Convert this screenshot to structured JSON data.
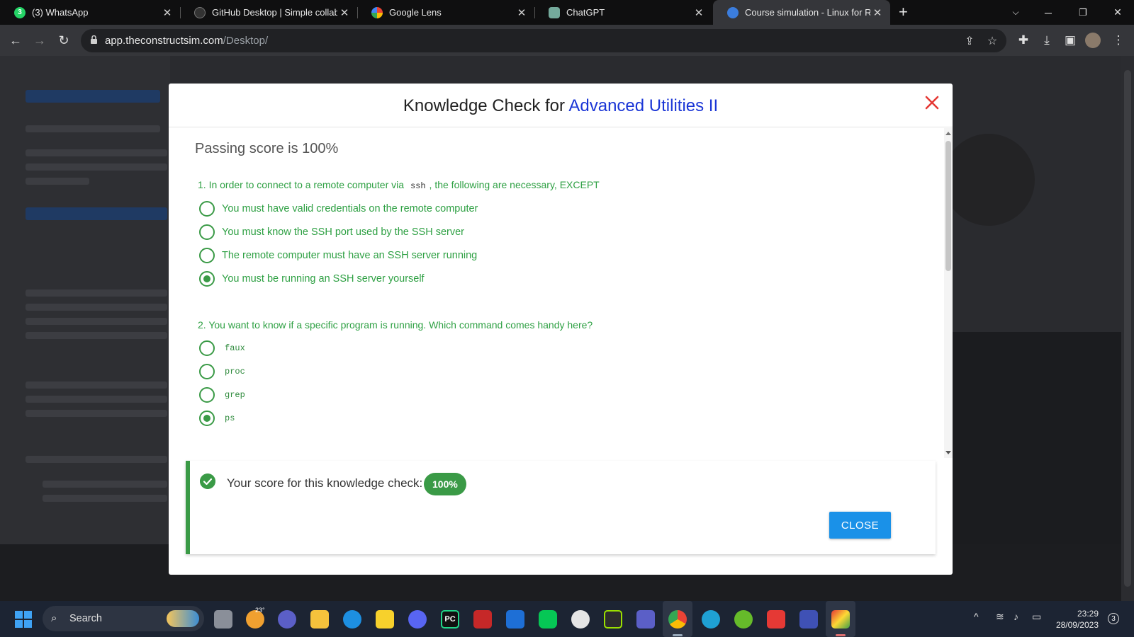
{
  "browser": {
    "tabs": [
      {
        "title": "(3) WhatsApp",
        "icon": "whatsapp-icon",
        "color": "#25d366",
        "badge": "3"
      },
      {
        "title": "GitHub Desktop | Simple collabo",
        "icon": "github-icon",
        "color": "#333333"
      },
      {
        "title": "Google Lens",
        "icon": "google-lens-icon",
        "color": "#4285f4"
      },
      {
        "title": "ChatGPT",
        "icon": "chatgpt-icon",
        "color": "#74aa9c"
      },
      {
        "title": "Course simulation - Linux for Ro",
        "icon": "constructsim-icon",
        "color": "#3b7ddd"
      }
    ],
    "address": {
      "domain": "app.theconstructsim.com",
      "path": "/Desktop/"
    }
  },
  "modal": {
    "title_prefix": "Knowledge Check for ",
    "title_accent": "Advanced Utilities II",
    "passing_score": "Passing score is 100%",
    "questions": [
      {
        "text_before": "1. In order to connect to a remote computer via ",
        "code": "ssh",
        "text_after": ", the following are necessary, EXCEPT",
        "options": [
          {
            "label": "You must have valid credentials on the remote computer",
            "selected": false
          },
          {
            "label": "You must know the SSH port used by the SSH server",
            "selected": false
          },
          {
            "label": "The remote computer must have an SSH server running",
            "selected": false
          },
          {
            "label": "You must be running an SSH server yourself",
            "selected": true
          }
        ]
      },
      {
        "text": "2. You want to know if a specific program is running. Which command comes handy here?",
        "options": [
          {
            "label": "faux",
            "selected": false
          },
          {
            "label": "proc",
            "selected": false
          },
          {
            "label": "grep",
            "selected": false
          },
          {
            "label": "ps",
            "selected": true
          }
        ]
      }
    ],
    "result": {
      "text": "Your score for this knowledge check:",
      "score": "100%"
    },
    "close_label": "CLOSE",
    "accent_color": "#1a35d6",
    "success_color": "#3a9a46",
    "close_color": "#e53935"
  },
  "taskbar": {
    "search_label": "Search",
    "weather": "23°",
    "time": "23:29",
    "date": "28/09/2023",
    "notifications": "3"
  }
}
